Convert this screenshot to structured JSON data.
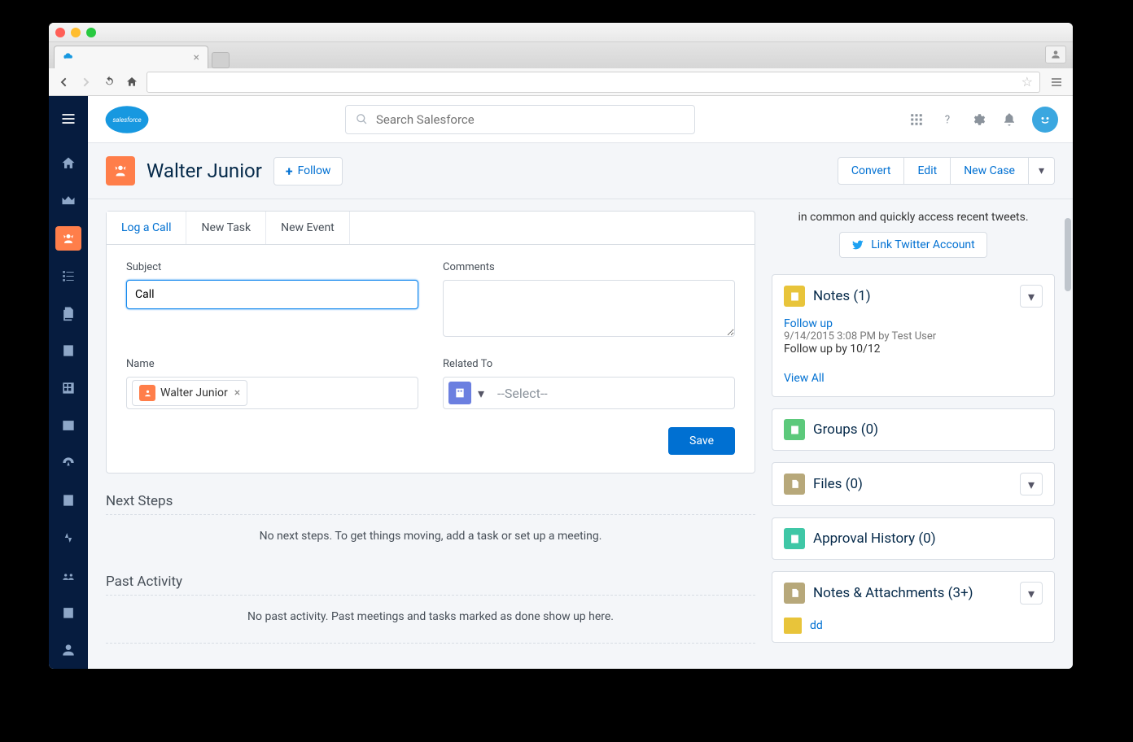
{
  "browser": {
    "tab_title": ""
  },
  "global": {
    "search_placeholder": "Search Salesforce"
  },
  "record": {
    "title": "Walter Junior",
    "follow_label": "Follow",
    "actions": {
      "convert": "Convert",
      "edit": "Edit",
      "new_case": "New Case"
    }
  },
  "activity": {
    "tabs": {
      "log_call": "Log a Call",
      "new_task": "New Task",
      "new_event": "New Event"
    },
    "labels": {
      "subject": "Subject",
      "comments": "Comments",
      "name": "Name",
      "related_to": "Related To"
    },
    "subject_value": "Call",
    "name_pill": "Walter Junior",
    "related_placeholder": "--Select--",
    "save": "Save"
  },
  "sections": {
    "next_steps": "Next Steps",
    "next_steps_empty": "No next steps. To get things moving, add a task or set up a meeting.",
    "past_activity": "Past Activity",
    "past_activity_empty": "No past activity. Past meetings and tasks marked as done show up here."
  },
  "sidebar": {
    "twitter_text": "in common and quickly access recent tweets.",
    "twitter_btn": "Link Twitter Account",
    "notes": {
      "title": "Notes (1)",
      "link": "Follow up",
      "meta": "9/14/2015 3:08 PM by Test User",
      "text": "Follow up by 10/12",
      "view_all": "View All"
    },
    "groups_title": "Groups (0)",
    "files_title": "Files (0)",
    "approval_title": "Approval History (0)",
    "attach_title": "Notes & Attachments (3+)",
    "attach_item": "dd"
  }
}
